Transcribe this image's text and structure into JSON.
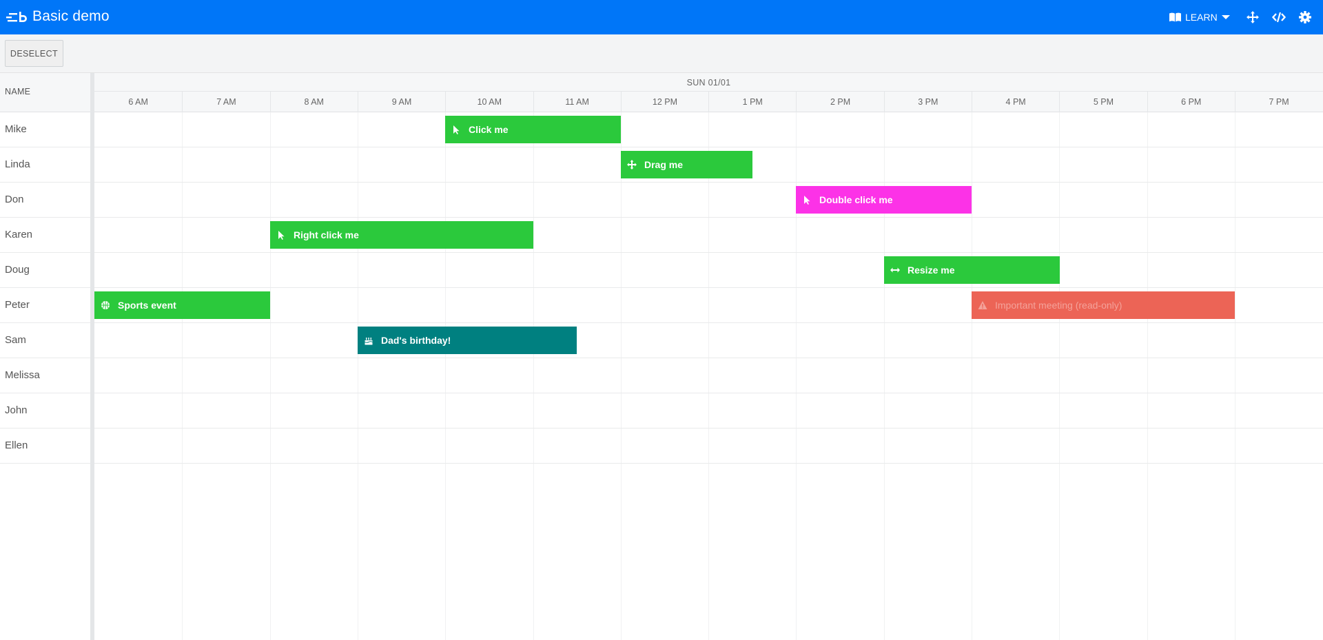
{
  "header": {
    "title": "Basic demo",
    "learn_label": "LEARN",
    "icons": [
      "learn-book-icon",
      "chevron-down-icon",
      "fullscreen-move-icon",
      "code-icon",
      "gear-icon"
    ],
    "background_color": "#0076f8"
  },
  "toolbar": {
    "deselect_label": "DESELECT"
  },
  "scheduler": {
    "name_column_header": "NAME",
    "day_label": "SUN 01/01",
    "hours": [
      "6 AM",
      "7 AM",
      "8 AM",
      "9 AM",
      "10 AM",
      "11 AM",
      "12 PM",
      "1 PM",
      "2 PM",
      "3 PM",
      "4 PM",
      "5 PM",
      "6 PM",
      "7 PM"
    ],
    "resources": [
      "Mike",
      "Linda",
      "Don",
      "Karen",
      "Doug",
      "Peter",
      "Sam",
      "Melissa",
      "John",
      "Ellen"
    ],
    "events": [
      {
        "name": "Click me",
        "resource": "Mike",
        "start": 10,
        "end": 12,
        "color": "#2bc93c",
        "icon": "pointer-icon",
        "readonly": false
      },
      {
        "name": "Drag me",
        "resource": "Linda",
        "start": 12,
        "end": 13.5,
        "color": "#2bc93c",
        "icon": "move-arrows-icon",
        "readonly": false
      },
      {
        "name": "Double click me",
        "resource": "Don",
        "start": 14,
        "end": 16,
        "color": "#fc32e7",
        "icon": "pointer-icon",
        "readonly": false
      },
      {
        "name": "Right click me",
        "resource": "Karen",
        "start": 8,
        "end": 11,
        "color": "#2bc93c",
        "icon": "pointer-icon",
        "readonly": false
      },
      {
        "name": "Resize me",
        "resource": "Doug",
        "start": 15,
        "end": 17,
        "color": "#2bc93c",
        "icon": "resize-arrows-icon",
        "readonly": false
      },
      {
        "name": "Sports event",
        "resource": "Peter",
        "start": 6,
        "end": 8,
        "color": "#2bc93c",
        "icon": "basketball-icon",
        "readonly": false
      },
      {
        "name": "Important meeting (read-only)",
        "resource": "Peter",
        "start": 16,
        "end": 19,
        "color": "#ec6456",
        "icon": "warning-icon",
        "readonly": true
      },
      {
        "name": "Dad's birthday!",
        "resource": "Sam",
        "start": 9,
        "end": 11.5,
        "color": "#008080",
        "icon": "birthday-cake-icon",
        "readonly": false
      }
    ]
  }
}
